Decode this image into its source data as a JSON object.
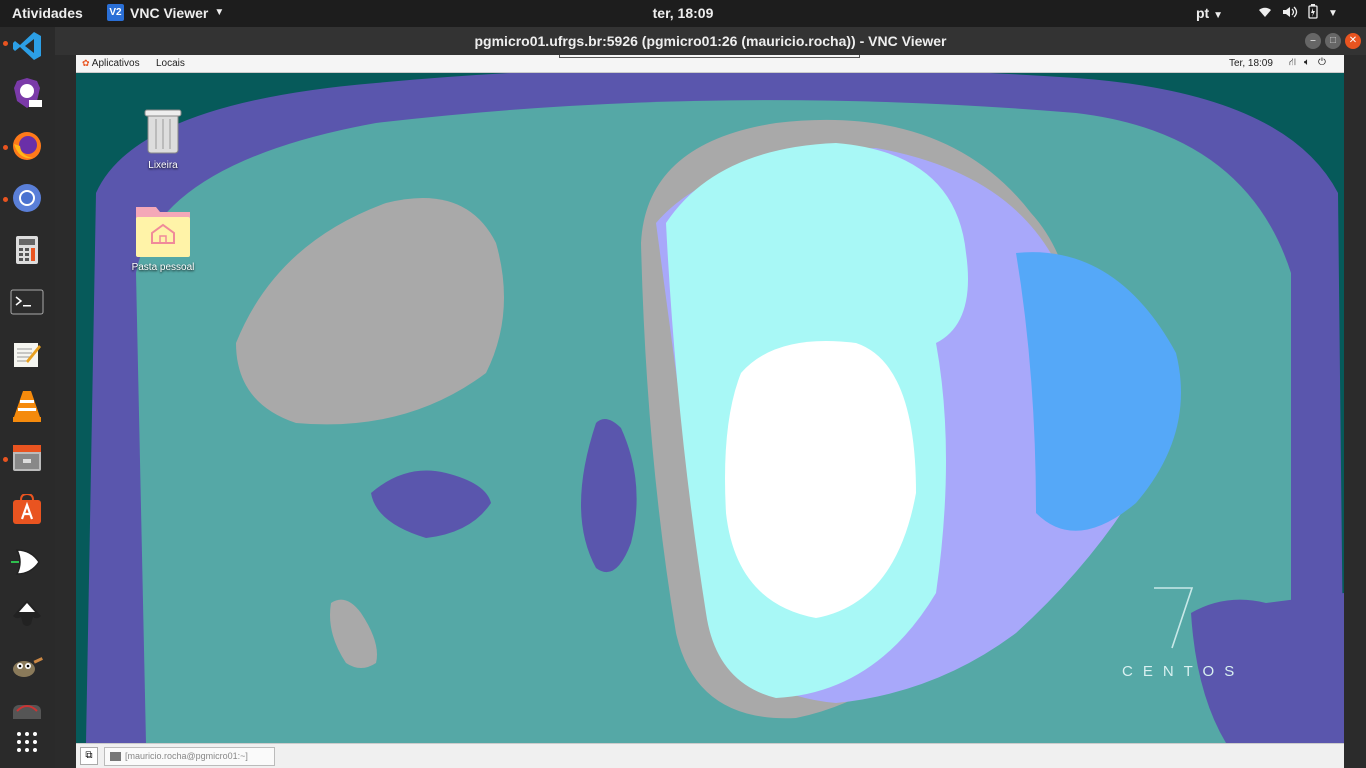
{
  "topbar": {
    "activities": "Atividades",
    "app_name": "VNC Viewer",
    "app_icon_text": "V2",
    "clock": "ter, 18:09",
    "language": "pt"
  },
  "dock": {
    "items": [
      "vscode-icon",
      "brave-icon",
      "firefox-icon",
      "chromium-icon",
      "calculator-icon",
      "terminal-icon",
      "text-editor-icon",
      "vlc-icon",
      "files-icon",
      "software-center-icon",
      "logisim-icon",
      "inkscape-icon",
      "gimp-icon",
      "disk-icon"
    ],
    "show_apps_label": "⋮⋮⋮"
  },
  "window": {
    "title": "pgmicro01.ufrgs.br:5926 (pgmicro01:26 (mauricio.rocha)) - VNC Viewer"
  },
  "remote": {
    "menu_apps": "Aplicativos",
    "menu_places": "Locais",
    "time": "Ter, 18:09",
    "desktop_icons": {
      "trash_label": "Lixeira",
      "home_label": "Pasta pessoal"
    },
    "wallpaper_logo_number": "7",
    "wallpaper_logo_text": "CENTOS",
    "taskbar_item": "[mauricio.rocha@pgmicro01:~]"
  },
  "colors": {
    "topbar_bg": "#1d1d1d",
    "dock_bg": "#2a2a2a",
    "accent_dot": "#e95420",
    "wall_teal": "#54aaa8",
    "wall_purple": "#5a56ad",
    "wall_grey": "#a8a8a8",
    "wall_cyan": "#a8f8f6",
    "wall_lavender": "#a8a8fa",
    "wall_blue": "#55a8f8"
  }
}
